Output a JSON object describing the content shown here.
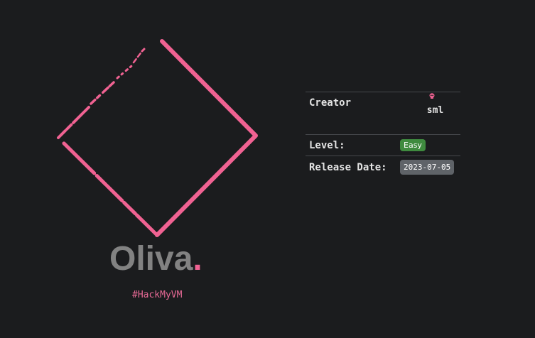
{
  "machine": {
    "name": "Oliva",
    "name_dot": ".",
    "platform_tag": "#HackMyVM"
  },
  "info": {
    "creator_label": "Creator",
    "creator_icon": "skull-icon",
    "creator_name": "sml",
    "level_label": "Level:",
    "level_value": "Easy",
    "release_label": "Release Date:",
    "release_value": "2023-07-05"
  },
  "colors": {
    "background": "#1b1c1e",
    "accent": "#f06292",
    "title": "#828282",
    "easy_badge": "#3f8b3f",
    "date_badge": "#5f6368"
  }
}
